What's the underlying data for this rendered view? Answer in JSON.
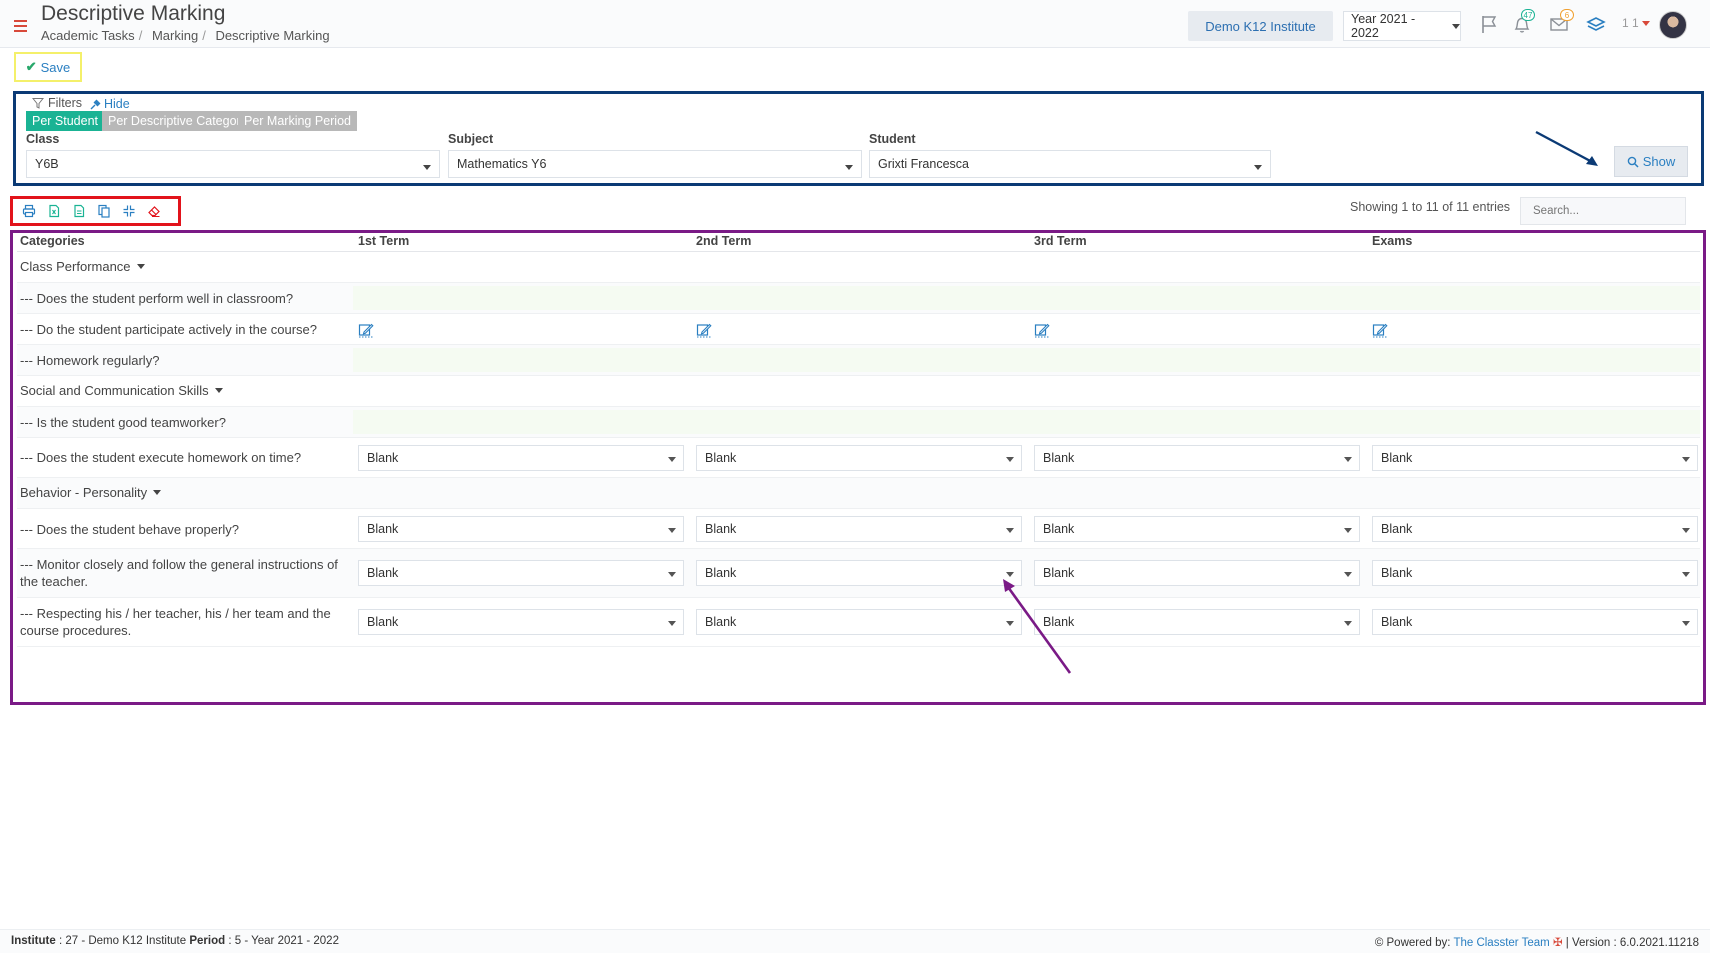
{
  "header": {
    "title": "Descriptive Marking",
    "breadcrumb": [
      "Academic Tasks",
      "Marking",
      "Descriptive Marking"
    ],
    "institute": "Demo K12 Institute",
    "year": "Year 2021 - 2022",
    "notifications_count": "47",
    "messages_count": "6",
    "user_label": "1 1",
    "icons": [
      "menu-icon",
      "flag-icon",
      "bell-icon",
      "envelope-icon",
      "layers-icon"
    ]
  },
  "toolbar": {
    "save_label": "Save"
  },
  "filters": {
    "label": "Filters",
    "hide_label": "Hide",
    "tabs": [
      "Per Student",
      "Per Descriptive Category",
      "Per Marking Period"
    ],
    "class_label": "Class",
    "class_value": "Y6B",
    "subject_label": "Subject",
    "subject_value": "Mathematics Y6",
    "student_label": "Student",
    "student_value": "Grixti Francesca",
    "show_label": "Show"
  },
  "table_tools": {
    "icons": [
      "print-icon",
      "excel-icon",
      "csv-icon",
      "copy-icon",
      "compress-icon",
      "eraser-icon"
    ],
    "entries_info": "Showing 1 to 11 of 11 entries",
    "search_placeholder": "Search..."
  },
  "table": {
    "columns": [
      "Categories",
      "1st Term",
      "2nd Term",
      "3rd Term",
      "Exams"
    ],
    "rows": [
      {
        "text": "Class Performance",
        "kind": "category"
      },
      {
        "text": "--- Does the student perform well in classroom?",
        "kind": "empty"
      },
      {
        "text": "--- Do the student participate actively in the course?",
        "kind": "edit"
      },
      {
        "text": "--- Homework regularly?",
        "kind": "empty"
      },
      {
        "text": "Social and Communication Skills",
        "kind": "category"
      },
      {
        "text": "--- Is the student good teamworker?",
        "kind": "empty"
      },
      {
        "text": "--- Does the student execute homework on time?",
        "kind": "select",
        "values": [
          "Blank",
          "Blank",
          "Blank",
          "Blank"
        ]
      },
      {
        "text": "Behavior - Personality",
        "kind": "category"
      },
      {
        "text": "--- Does the student behave properly?",
        "kind": "select",
        "values": [
          "Blank",
          "Blank",
          "Blank",
          "Blank"
        ]
      },
      {
        "text": "--- Monitor closely and follow the general instructions of the teacher.",
        "kind": "select",
        "values": [
          "Blank",
          "Blank",
          "Blank",
          "Blank"
        ]
      },
      {
        "text": "--- Respecting his / her teacher, his / her team and the course procedures.",
        "kind": "select",
        "values": [
          "Blank",
          "Blank",
          "Blank",
          "Blank"
        ]
      }
    ]
  },
  "footer": {
    "institute_label": "Institute",
    "institute_value": ": 27 - Demo K12 Institute",
    "period_label": "Period",
    "period_value": ": 5 - Year 2021 - 2022",
    "powered_by": "Powered by:",
    "team": "The Classter Team",
    "version": "| Version : 6.0.2021.11218"
  },
  "colors": {
    "accent": "#2a7fc1",
    "active_tab": "#1ab394",
    "filters_border": "#0b3a75",
    "toolbar_border": "#e2131b",
    "table_border": "#7a1a86",
    "save_border": "#f4f06a"
  }
}
